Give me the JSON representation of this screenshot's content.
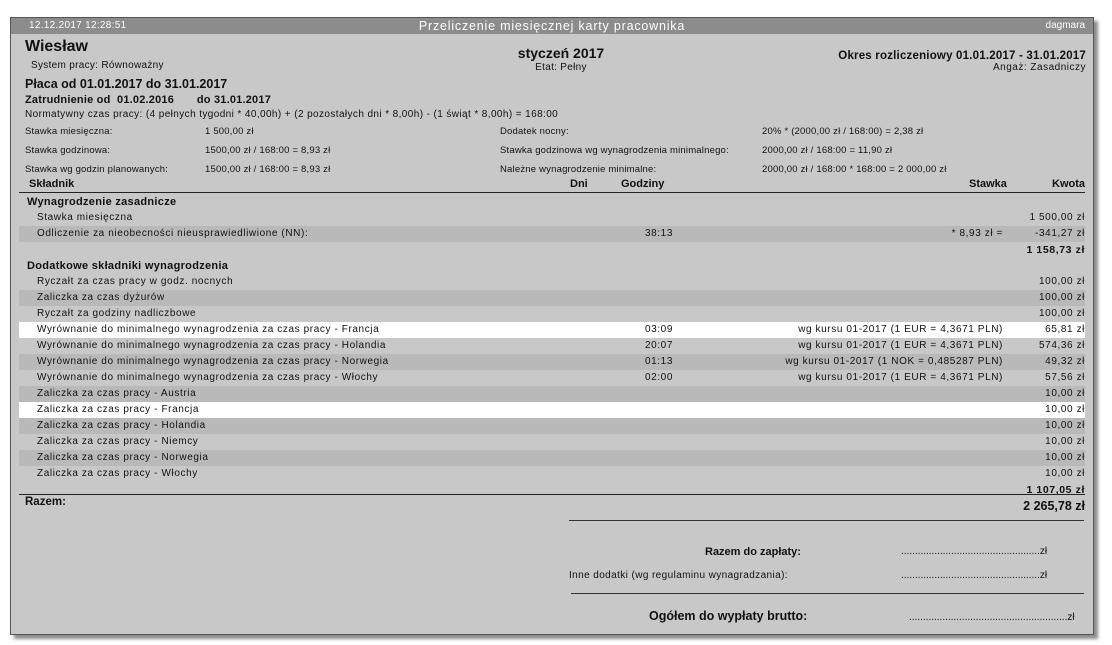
{
  "window": {
    "datetime": "12.12.2017  12:28:51",
    "title": "Przeliczenie miesięcznej karty pracownika",
    "user": "dagmara"
  },
  "header": {
    "employee_name": "Wiesław",
    "work_system": "System pracy: Równoważny",
    "month": "styczeń 2017",
    "etat": "Etat: Pełny",
    "period": "Okres rozliczeniowy 01.01.2017 - 31.01.2017",
    "engagement": "Angaż: Zasadniczy",
    "salary_period": "Płaca od 01.01.2017  do  31.01.2017",
    "employment": "Zatrudnienie od  01.02.2016       do 31.01.2017",
    "normative_time": "Normatywny czas pracy:  (4 pełnych tygodni * 40,00h) + (2 pozostałych dni * 8,00h) - (1 świąt * 8,00h) = 168:00"
  },
  "info": {
    "monthly_rate_label": "Stawka miesięczna:",
    "monthly_rate_value": "1 500,00 zł",
    "hourly_rate_label": "Stawka godzinowa:",
    "hourly_rate_value": "1500,00 zł / 168:00 = 8,93 zł",
    "planned_rate_label": "Stawka wg godzin planowanych:",
    "planned_rate_value": "1500,00 zł / 168:00 = 8,93 zł",
    "night_bonus_label": "Dodatek nocny:",
    "night_bonus_value": "20% * (2000,00 zł / 168:00) = 2,38 zł",
    "min_hourly_label": "Stawka godzinowa wg wynagrodzenia minimalnego:",
    "min_hourly_value": "2000,00 zł / 168:00 = 11,90 zł",
    "min_due_label": "Należne wynagrodzenie minimalne:",
    "min_due_value": "2000,00 zł / 168:00 * 168:00 = 2 000,00 zł"
  },
  "table": {
    "headers": {
      "component": "Składnik",
      "days": "Dni",
      "hours": "Godziny",
      "rate": "Stawka",
      "amount": "Kwota"
    },
    "rows": [
      {
        "name": "Wynagrodzenie zasadnicze",
        "hours": "",
        "rate": "",
        "amount": ""
      },
      {
        "name": "Stawka miesięczna",
        "hours": "",
        "rate": "",
        "amount": "1 500,00 zł"
      },
      {
        "name": "Odliczenie za nieobecności nieusprawiedliwione (NN):",
        "hours": "38:13",
        "rate": "* 8,93 zł =",
        "amount": "-341,27 zł"
      },
      {
        "name": "",
        "hours": "",
        "rate": "",
        "amount": "1 158,73 zł"
      },
      {
        "name": "Dodatkowe składniki wynagrodzenia",
        "hours": "",
        "rate": "",
        "amount": ""
      },
      {
        "name": "Ryczałt za czas pracy w godz. nocnych",
        "hours": "",
        "rate": "",
        "amount": "100,00 zł"
      },
      {
        "name": "Zaliczka za czas dyżurów",
        "hours": "",
        "rate": "",
        "amount": "100,00 zł"
      },
      {
        "name": "Ryczałt za godziny nadliczbowe",
        "hours": "",
        "rate": "",
        "amount": "100,00 zł"
      },
      {
        "name": "Wyrównanie do minimalnego wynagrodzenia za czas pracy - Francja",
        "hours": "03:09",
        "rate": "wg kursu 01-2017 (1 EUR = 4,3671 PLN)",
        "amount": "65,81 zł"
      },
      {
        "name": "Wyrównanie do minimalnego wynagrodzenia za czas pracy - Holandia",
        "hours": "20:07",
        "rate": "wg kursu 01-2017 (1 EUR = 4,3671 PLN)",
        "amount": "574,36 zł"
      },
      {
        "name": "Wyrównanie do minimalnego wynagrodzenia za czas pracy - Norwegia",
        "hours": "01:13",
        "rate": "wg kursu 01-2017 (1 NOK = 0,485287 PLN)",
        "amount": "49,32 zł"
      },
      {
        "name": "Wyrównanie do minimalnego wynagrodzenia za czas pracy - Włochy",
        "hours": "02:00",
        "rate": "wg kursu 01-2017 (1 EUR = 4,3671 PLN)",
        "amount": "57,56 zł"
      },
      {
        "name": "Zaliczka za czas pracy - Austria",
        "hours": "",
        "rate": "",
        "amount": "10,00 zł"
      },
      {
        "name": "Zaliczka za czas pracy - Francja",
        "hours": "",
        "rate": "",
        "amount": "10,00 zł"
      },
      {
        "name": "Zaliczka za czas pracy - Holandia",
        "hours": "",
        "rate": "",
        "amount": "10,00 zł"
      },
      {
        "name": "Zaliczka za czas pracy - Niemcy",
        "hours": "",
        "rate": "",
        "amount": "10,00 zł"
      },
      {
        "name": "Zaliczka za czas pracy - Norwegia",
        "hours": "",
        "rate": "",
        "amount": "10,00 zł"
      },
      {
        "name": "Zaliczka za czas pracy - Włochy",
        "hours": "",
        "rate": "",
        "amount": "10,00 zł"
      },
      {
        "name": "",
        "hours": "",
        "rate": "",
        "amount": "1 107,05 zł"
      }
    ]
  },
  "summary": {
    "total_label": "Razem:",
    "total_value": "2 265,78 zł",
    "to_pay_label": "Razem do zapłaty:",
    "to_pay_value": "..................................................zł",
    "other_label": "Inne dodatki (wg regulaminu wynagradzania):",
    "other_value": "..................................................zł",
    "gross_label": "Ogółem do wypłaty brutto:",
    "gross_value": ".........................................................zł"
  }
}
